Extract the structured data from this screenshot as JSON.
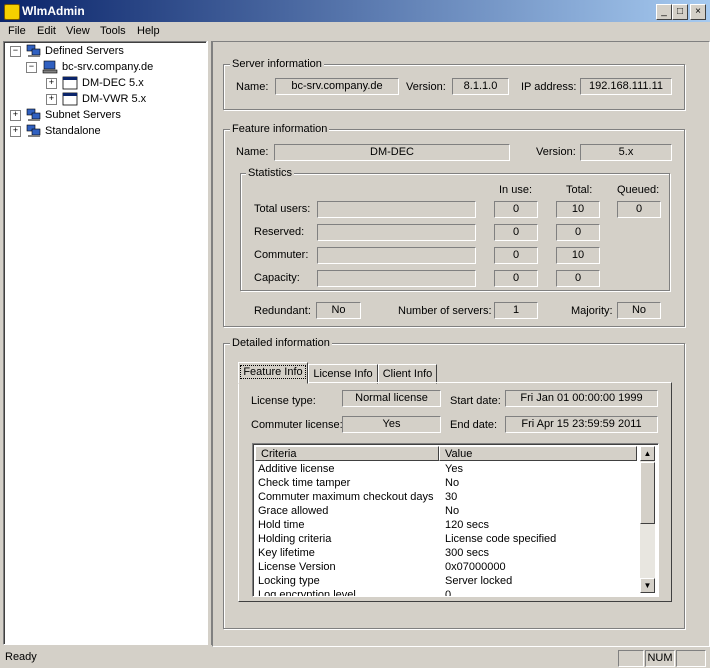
{
  "window": {
    "title": "WlmAdmin"
  },
  "menu": [
    "File",
    "Edit",
    "View",
    "Tools",
    "Help"
  ],
  "tree": {
    "defined_servers": "Defined Servers",
    "server": "bc-srv.company.de",
    "feature1": "DM-DEC 5.x",
    "feature2": "DM-VWR 5.x",
    "subnet_servers": "Subnet Servers",
    "standalone": "Standalone"
  },
  "server_info": {
    "legend": "Server information",
    "name_label": "Name:",
    "name": "bc-srv.company.de",
    "version_label": "Version:",
    "version": "8.1.1.0",
    "ip_label": "IP address:",
    "ip": "192.168.111.11"
  },
  "feature_info": {
    "legend": "Feature information",
    "name_label": "Name:",
    "name": "DM-DEC",
    "version_label": "Version:",
    "version": "5.x",
    "statistics": {
      "legend": "Statistics",
      "col_inuse": "In use:",
      "col_total": "Total:",
      "col_queued": "Queued:",
      "rows": [
        {
          "label": "Total users:",
          "inuse": "0",
          "total": "10",
          "queued": "0"
        },
        {
          "label": "Reserved:",
          "inuse": "0",
          "total": "0"
        },
        {
          "label": "Commuter:",
          "inuse": "0",
          "total": "10"
        },
        {
          "label": "Capacity:",
          "inuse": "0",
          "total": "0"
        }
      ]
    },
    "redundant_label": "Redundant:",
    "redundant": "No",
    "num_servers_label": "Number of servers:",
    "num_servers": "1",
    "majority_label": "Majority:",
    "majority": "No"
  },
  "detailed": {
    "legend": "Detailed information",
    "tabs": [
      "Feature Info",
      "License Info",
      "Client Info"
    ],
    "license_type_label": "License type:",
    "license_type": "Normal license",
    "start_date_label": "Start date:",
    "start_date": "Fri Jan 01 00:00:00 1999",
    "commuter_label": "Commuter license:",
    "commuter": "Yes",
    "end_date_label": "End date:",
    "end_date": "Fri Apr 15 23:59:59 2011",
    "columns": [
      "Criteria",
      "Value"
    ],
    "rows": [
      {
        "criteria": "Additive license",
        "value": "Yes"
      },
      {
        "criteria": "Check time tamper",
        "value": "No"
      },
      {
        "criteria": "Commuter maximum checkout days",
        "value": "30"
      },
      {
        "criteria": "Grace allowed",
        "value": "No"
      },
      {
        "criteria": "Hold time",
        "value": "120 secs"
      },
      {
        "criteria": "Holding criteria",
        "value": "License code specified"
      },
      {
        "criteria": "Key lifetime",
        "value": "300 secs"
      },
      {
        "criteria": "License Version",
        "value": "0x07000000"
      },
      {
        "criteria": "Locking type",
        "value": "Server locked"
      },
      {
        "criteria": "Log encryption level",
        "value": "0"
      }
    ]
  },
  "status": {
    "text": "Ready",
    "num": "NUM"
  }
}
